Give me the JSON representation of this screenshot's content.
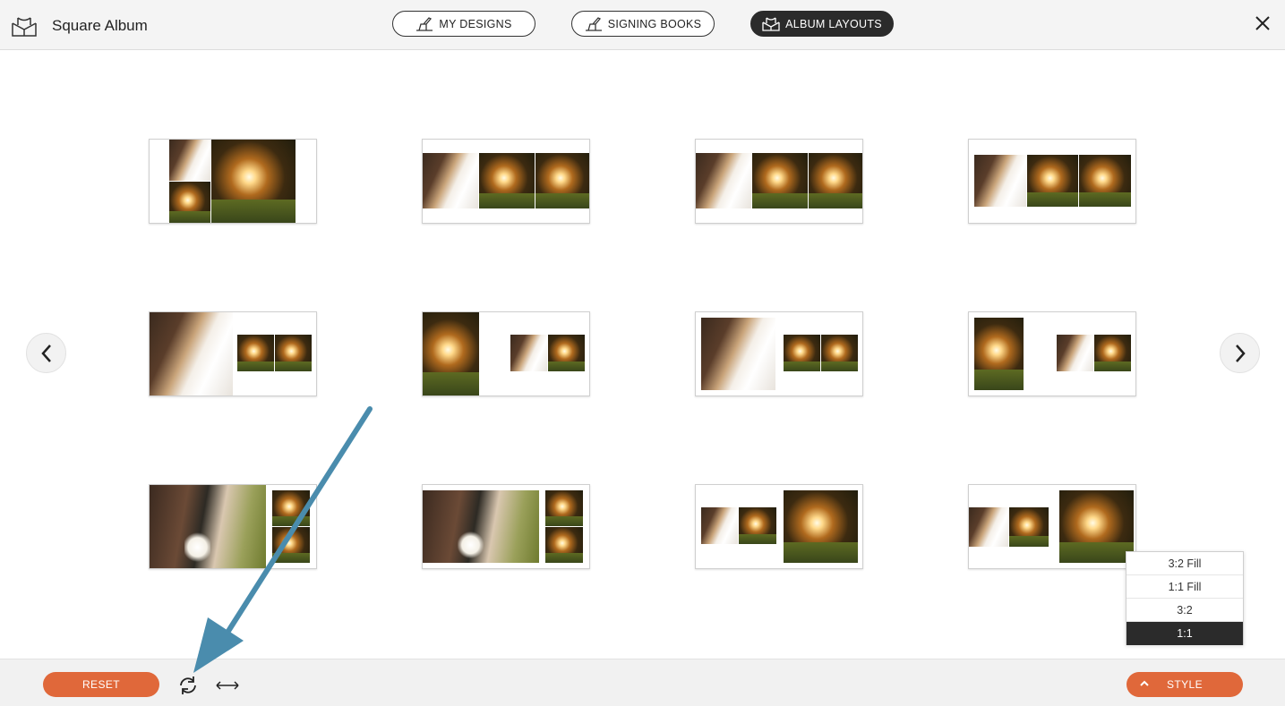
{
  "app": {
    "title": "Square Album"
  },
  "nav": {
    "my_designs": "MY DESIGNS",
    "signing_books": "SIGNING BOOKS",
    "album_layouts": "ALBUM LAYOUTS",
    "active": "album_layouts"
  },
  "bottom": {
    "reset_label": "RESET",
    "style_label": "STYLE"
  },
  "style_menu": {
    "options": [
      "3:2 Fill",
      "1:1 Fill",
      "3:2",
      "1:1"
    ],
    "selected": "1:1"
  },
  "layouts": {
    "count": 12,
    "rows": 3,
    "columns": 4
  },
  "colors": {
    "accent": "#e0683a",
    "active_nav": "#2b2b2b",
    "annotation_arrow": "#4a8cad"
  },
  "icons": [
    "album-logo-icon",
    "hand-pen-icon",
    "close-icon",
    "chevron-left-icon",
    "chevron-right-icon",
    "rotate-icon",
    "swap-horizontal-icon",
    "chevron-up-icon"
  ]
}
